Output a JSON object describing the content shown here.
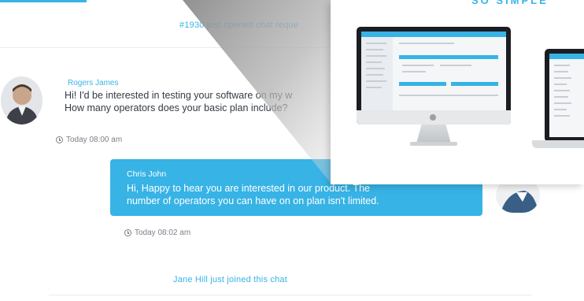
{
  "system_messages": {
    "opened_request": "#1930 just opened chat reque",
    "joined": "Jane Hill just joined this chat"
  },
  "incoming_message": {
    "author": "Rogers James",
    "line1": "Hi! I'd be interested in testing your software on my w",
    "line2": "How many operators does your basic plan include?",
    "time": "Today 08:00 am"
  },
  "outgoing_message": {
    "author": "Chris John",
    "line1": "Hi, Happy to hear you are interested in our product. The",
    "line2": "number of operators you can have on on plan isn't limited.",
    "time": "Today 08:02 am"
  },
  "promo": {
    "heading": "SO SIMPLE"
  },
  "colors": {
    "accent": "#37b3e6",
    "text": "#333b44",
    "muted": "#7b8088"
  },
  "icons": [
    "clock-icon",
    "clock-icon"
  ]
}
